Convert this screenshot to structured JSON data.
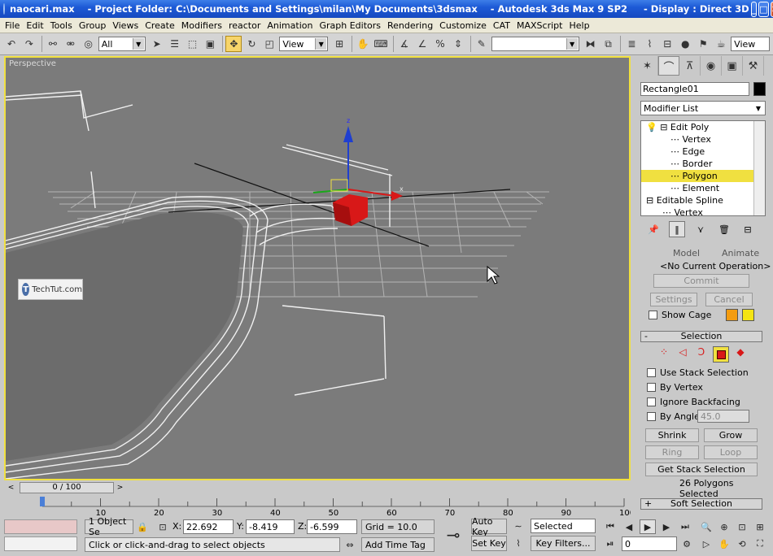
{
  "titlebar": {
    "title": "naocari.max    - Project Folder: C:\\Documents and Settings\\milan\\My Documents\\3dsmax    - Autodesk 3ds Max 9 SP2     - Display : Direct 3D",
    "minimize": "_",
    "maximize": "□",
    "close": "✕"
  },
  "menubar": {
    "items": [
      "File",
      "Edit",
      "Tools",
      "Group",
      "Views",
      "Create",
      "Modifiers",
      "reactor",
      "Animation",
      "Graph Editors",
      "Rendering",
      "Customize",
      "CAT",
      "MAXScript",
      "Help"
    ]
  },
  "toolbar": {
    "selection_filter": "All",
    "ref_coord": "View",
    "named_selection": "",
    "right_view": "View"
  },
  "viewport": {
    "label": "Perspective",
    "watermark": "TechTut.com",
    "watermark_icon": "T",
    "gizmo_x": "x",
    "gizmo_z": "z"
  },
  "timeline": {
    "slider": "0 / 100",
    "prev": "<",
    "next": ">",
    "ticks": [
      "10",
      "20",
      "30",
      "40",
      "50",
      "60",
      "70",
      "80",
      "90",
      "100"
    ],
    "tick_values": [
      10,
      20,
      30,
      40,
      50,
      60,
      70,
      80,
      90,
      100
    ]
  },
  "status": {
    "selected_count": "1 Object Se",
    "x_label": "X:",
    "x_value": "22.692",
    "y_label": "Y:",
    "y_value": "-8.419",
    "z_label": "Z:",
    "z_value": "-6.599",
    "grid": "Grid = 10.0",
    "prompt": "Click or click-and-drag to select objects",
    "add_time_tag": "Add Time Tag",
    "auto_key": "Auto Key",
    "set_key": "Set Key",
    "key_mode": "Selected",
    "key_filters": "Key Filters...",
    "frame": "0"
  },
  "command_panel": {
    "object_name": "Rectangle01",
    "modifier_list": "Modifier List",
    "stack": [
      {
        "label": "Edit Poly",
        "level": 0,
        "selected": false
      },
      {
        "label": "Vertex",
        "level": 1,
        "selected": false
      },
      {
        "label": "Edge",
        "level": 1,
        "selected": false
      },
      {
        "label": "Border",
        "level": 1,
        "selected": false
      },
      {
        "label": "Polygon",
        "level": 1,
        "selected": true
      },
      {
        "label": "Element",
        "level": 1,
        "selected": false
      },
      {
        "label": "Editable Spline",
        "level": 0,
        "selected": false
      },
      {
        "label": "Vertex",
        "level": 1,
        "selected": false
      }
    ],
    "mode_model": "Model",
    "mode_animate": "Animate",
    "current_operation": "<No Current Operation>",
    "commit": "Commit",
    "settings": "Settings",
    "cancel": "Cancel",
    "show_cage": "Show Cage",
    "selection_rollout": "Selection",
    "selection_sign": "-",
    "use_stack_selection": "Use Stack Selection",
    "by_vertex": "By Vertex",
    "ignore_backfacing": "Ignore Backfacing",
    "by_angle": "By Angle:",
    "angle_value": "45.0",
    "shrink": "Shrink",
    "grow": "Grow",
    "ring": "Ring",
    "loop": "Loop",
    "get_stack_selection": "Get Stack Selection",
    "selection_status": "26 Polygons Selected",
    "soft_selection_rollout": "Soft Selection",
    "soft_sign": "+"
  },
  "colors": {
    "viewport_bg": "#7b7b7b",
    "active_border": "#f0e040",
    "selection_red": "#d81818",
    "titlebar_blue": "#1d5ad6"
  }
}
